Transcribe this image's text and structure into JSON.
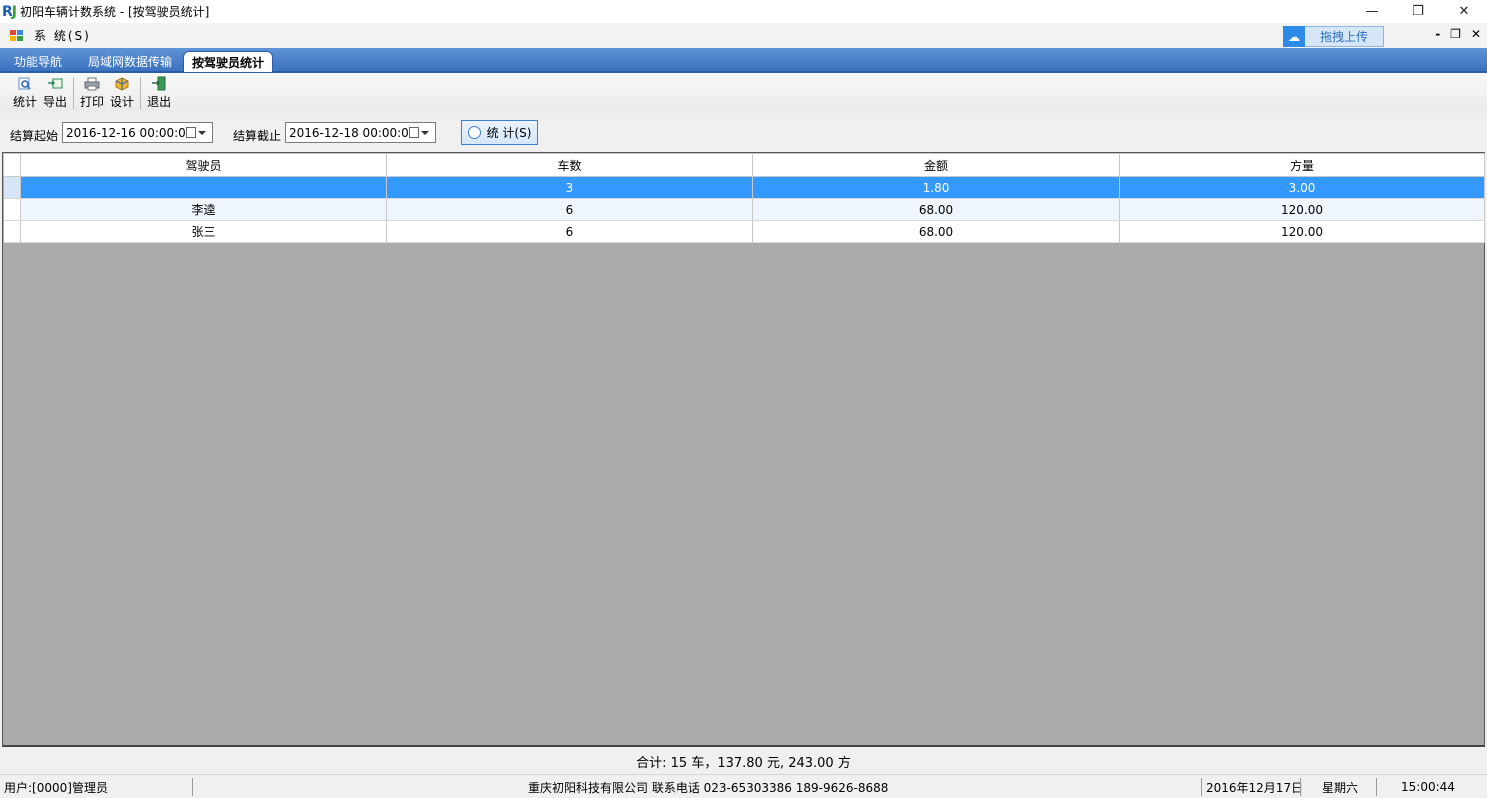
{
  "window": {
    "title": "初阳车辆计数系统 - [按驾驶员统计]",
    "logo": "RJ",
    "controls": [
      "—",
      "❐",
      "✕"
    ]
  },
  "menubar": {
    "system_label": "系 统(S)",
    "upload_label": "拖拽上传",
    "mdi_controls": [
      "-",
      "❐",
      "✕"
    ]
  },
  "tabs": [
    {
      "label": "功能导航",
      "active": false
    },
    {
      "label": "局域网数据传输",
      "active": false
    },
    {
      "label": "按驾驶员统计",
      "active": true
    }
  ],
  "toolbar": {
    "buttons": [
      {
        "label": "统计",
        "icon": "magnify-icon"
      },
      {
        "label": "导出",
        "icon": "export-icon"
      },
      {
        "label": "打印",
        "icon": "print-icon"
      },
      {
        "label": "设计",
        "icon": "design-icon"
      },
      {
        "label": "退出",
        "icon": "exit-icon"
      }
    ]
  },
  "filter": {
    "start_label": "结算起始",
    "start_value": "2016-12-16 00:00:00",
    "end_label": "结算截止",
    "end_value": "2016-12-18 00:00:00",
    "stat_button": "统 计(S)"
  },
  "grid": {
    "columns": [
      "驾驶员",
      "车数",
      "金额",
      "方量"
    ],
    "rows": [
      {
        "driver": "",
        "count": "3",
        "amount": "1.80",
        "volume": "3.00",
        "selected": true
      },
      {
        "driver": "李逵",
        "count": "6",
        "amount": "68.00",
        "volume": "120.00",
        "selected": false
      },
      {
        "driver": "张三",
        "count": "6",
        "amount": "68.00",
        "volume": "120.00",
        "selected": false
      }
    ]
  },
  "summary": "合计: 15 车，137.80 元, 243.00 方",
  "statusbar": {
    "user": "用户:[0000]管理员",
    "company": "重庆初阳科技有限公司 联系电话 023-65303386 189-9626-8688",
    "date": "2016年12月17日",
    "weekday": "星期六",
    "time": "15:00:44"
  },
  "colors": {
    "selection": "#3399ff",
    "tabstrip": "#3b73c0",
    "grid_background": "#ababab"
  }
}
